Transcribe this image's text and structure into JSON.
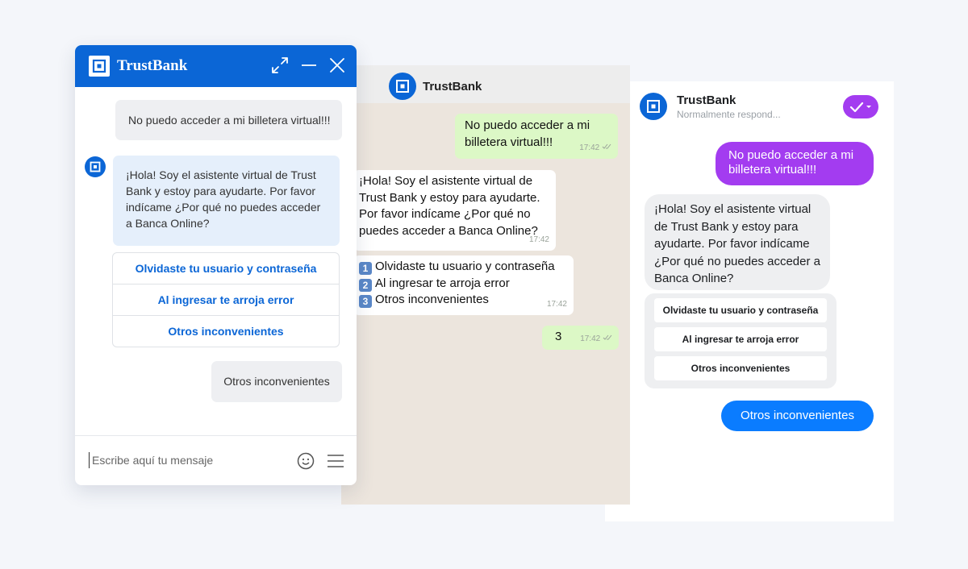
{
  "messenger": {
    "name": "TrustBank",
    "status": "Normalmente respond...",
    "user_msg_1": "No puedo acceder a mi billetera virtual!!!",
    "bot_msg": "¡Hola! Soy el asistente virtual de Trust Bank y estoy para ayudarte. Por favor indícame ¿Por qué no puedes acceder a Banca Online?",
    "options": [
      "Olvidaste tu usuario y contraseña",
      "Al ingresar te arroja error",
      "Otros inconvenientes"
    ],
    "user_msg_2": "Otros inconvenientes",
    "colors": {
      "user_bubble": "#a33cf0",
      "reply_bubble": "#0a7cff"
    }
  },
  "whatsapp": {
    "name": "TrustBank",
    "user_msg_1": "No puedo acceder a mi billetera virtual!!!",
    "user_msg_1_time": "17:42",
    "bot_msg": "¡Hola! Soy el asistente virtual de Trust Bank y estoy para ayudarte. Por favor indícame ¿Por qué no puedes acceder a Banca Online?",
    "bot_msg_time": "17:42",
    "options": [
      {
        "num": "1",
        "label": "Olvidaste tu usuario y contraseña"
      },
      {
        "num": "2",
        "label": "Al ingresar te arroja error"
      },
      {
        "num": "3",
        "label": "Otros inconvenientes"
      }
    ],
    "options_time": "17:42",
    "user_msg_2": "3",
    "user_msg_2_time": "17:42",
    "colors": {
      "out_bubble": "#dcf8c6",
      "background": "#ece5dd"
    }
  },
  "web": {
    "title": "TrustBank",
    "user_msg_1": "No puedo acceder a mi billetera virtual!!!",
    "bot_msg": "¡Hola! Soy el asistente virtual de Trust Bank y estoy para ayudarte. Por favor indícame ¿Por qué no puedes acceder a Banca Online?",
    "options": [
      "Olvidaste tu usuario y contraseña",
      "Al ingresar te arroja error",
      "Otros inconvenientes"
    ],
    "user_msg_2": "Otros inconvenientes",
    "input_placeholder": "Escribe aquí tu mensaje",
    "colors": {
      "brand": "#0b66d6",
      "bot_bubble": "#e5effb"
    }
  }
}
